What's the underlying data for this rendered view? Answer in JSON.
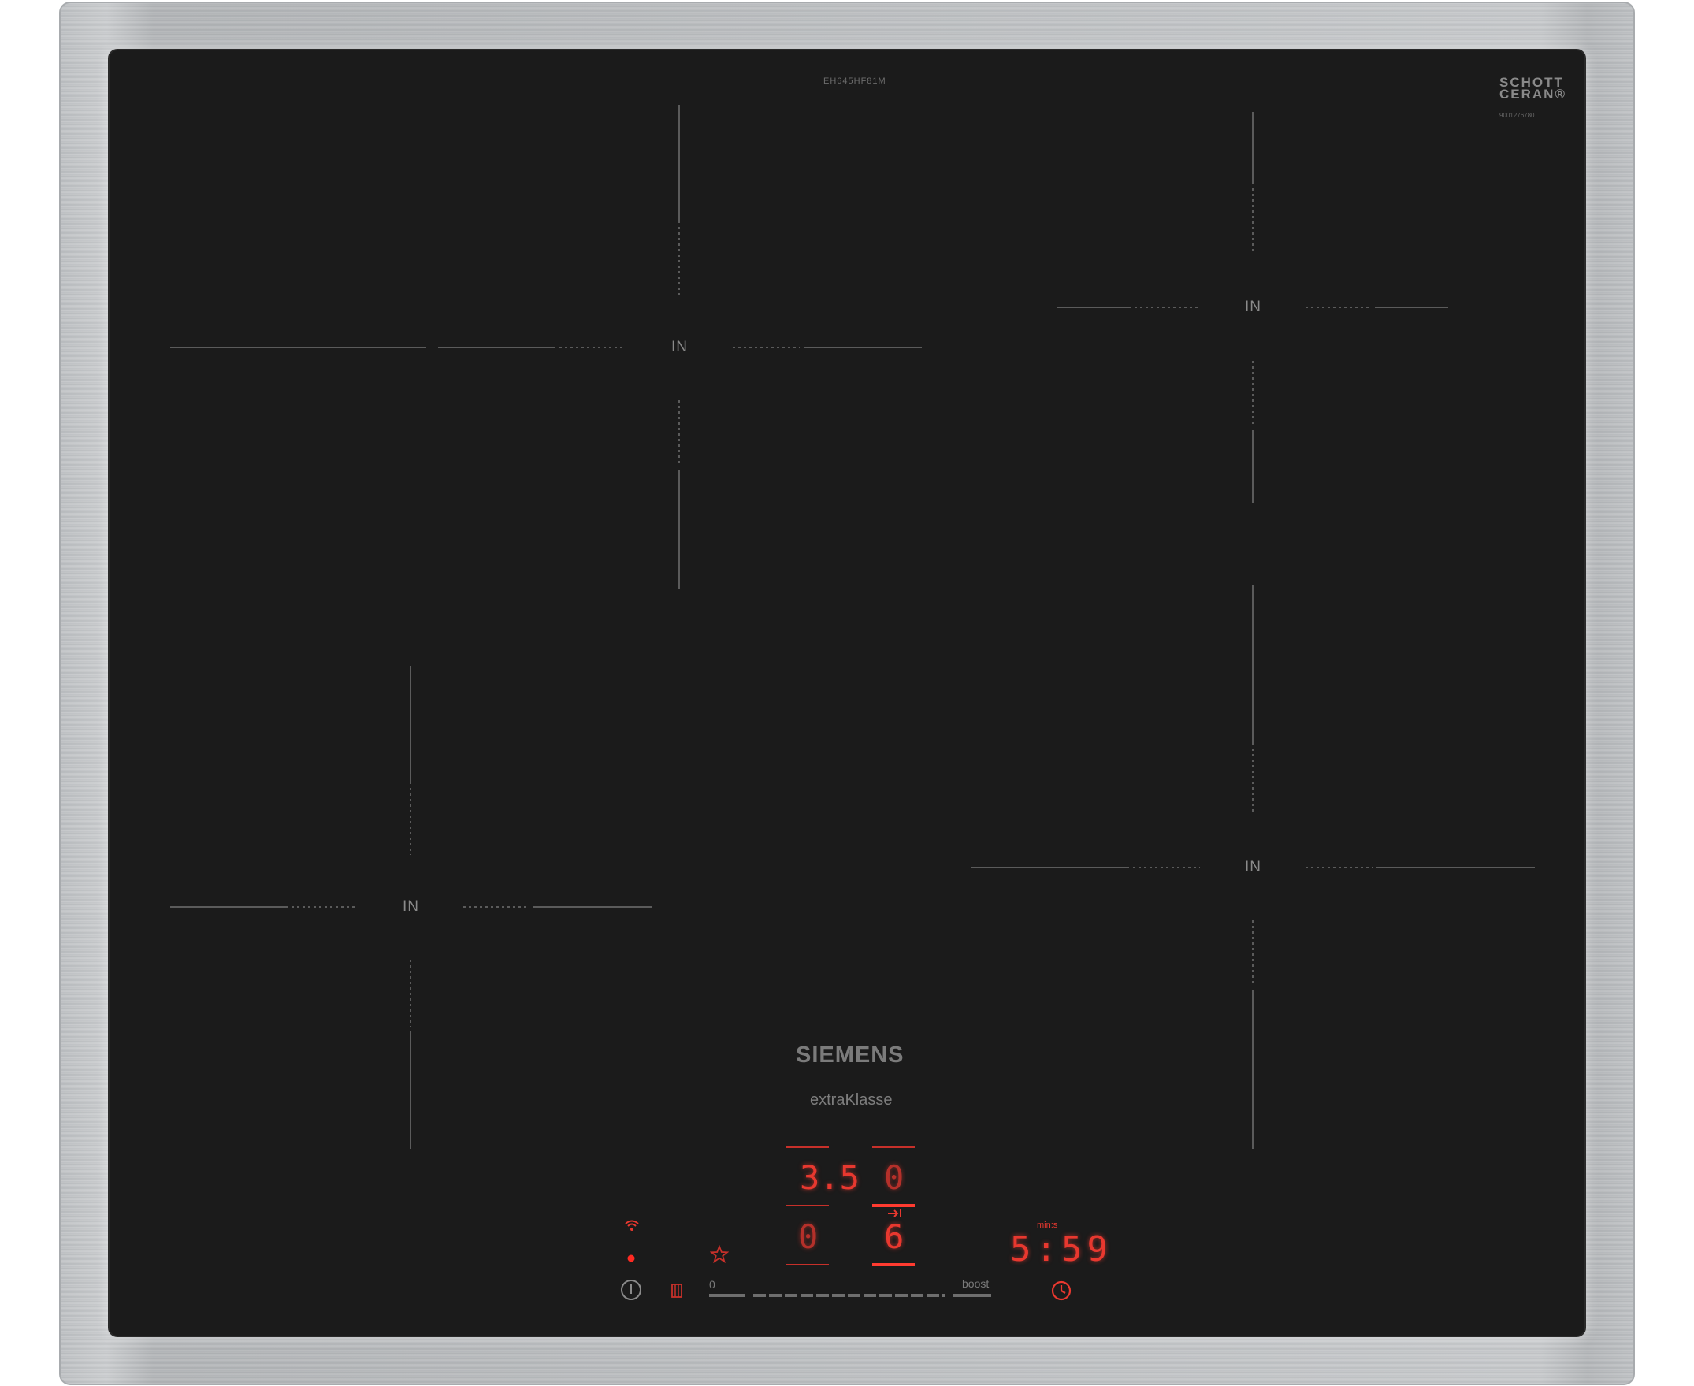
{
  "product": {
    "model_code": "EH645HF81M",
    "glass_brand": [
      "SCHOTT",
      "CERAN®"
    ],
    "glass_serial": "9001276780",
    "brand": "SIEMENS",
    "series": "extraKlasse"
  },
  "zones": [
    {
      "label": "IN"
    },
    {
      "label": "IN"
    },
    {
      "label": "IN"
    },
    {
      "label": "IN"
    }
  ],
  "control_panel": {
    "power_levels": {
      "top_left": "3.5",
      "top_right": "0",
      "bottom_left": "0",
      "bottom_right": "6"
    },
    "timer": {
      "unit_label": "min:s",
      "value": "5:59"
    },
    "slider": {
      "min_label": "0",
      "max_label": "boost"
    },
    "icons": {
      "wifi": "wifi-icon",
      "status": "status-dot-icon",
      "favorite": "star-icon",
      "power": "power-icon",
      "lock": "childlock-icon",
      "clock": "clock-icon",
      "transfer": "transfer-icon"
    }
  },
  "colors": {
    "glass": "#1b1b1b",
    "display_red": "#e8382f",
    "frame": "#c0c2c4"
  }
}
